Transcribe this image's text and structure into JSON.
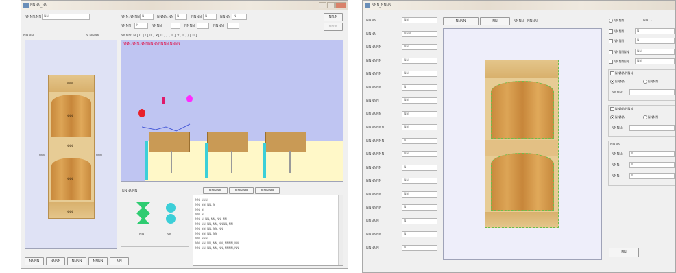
{
  "left_window": {
    "title": "NNNN_NN",
    "top_controls": {
      "field1_label": "NNNN:NN",
      "field1_value": "NN",
      "label_a": "NNN:NNNN",
      "label_b": "NNNN:NN",
      "label_c": "NNNN",
      "label_d": "NNNN",
      "button_right_top": "NN:N",
      "button_right_2": "NN:N",
      "label_e": "NNNN",
      "label_f": "NNNN",
      "label_g": "NNNN",
      "label_h": "NNNN",
      "val1": "N",
      "val2": "N",
      "val3": "N",
      "val4": "N",
      "val5": "N",
      "row3_text": "NNNN: N [ 0 ] / [ 0 ] ×[ 0 ] / [ 0 ] ×[ 0 ] / [ 0 ]",
      "left_panel_label": "NNNN",
      "left_panel_label2": "N NNNN"
    },
    "red_status_text": "NNN:NNN:NNNNNNNNNNN:NNNN",
    "preview_labels": {
      "top": "NNN",
      "upper": "NNN",
      "mid": "NNN",
      "lower": "NNN",
      "bottom": "NNN",
      "left_mark": "NNN",
      "right_mark": "NNN"
    },
    "bottom_left_panel_title": "NNNNNN",
    "legend_icons": [
      {
        "name": "green-x",
        "color": "#2ecc71",
        "label": "NN"
      },
      {
        "name": "cyan-circle",
        "color": "#3ccfd8",
        "label": "NN"
      }
    ],
    "tabs": [
      "NNNNN",
      "NNNNN",
      "NNNNN"
    ],
    "log_lines": [
      "NN: NNN",
      "NN: NN, NN, N",
      "NN: N",
      "NN: N",
      "NN: N, NN, NN, NN, NN",
      "NN: NN, NN, NN, NNNN, NN",
      "NN: NN, NN, NN, NN",
      "NN: NN, NN, NN",
      "NN: NNN",
      "NN: NN, NN, NN, NN, NNNN, NN",
      "NN: NN, NN, NN, NN, NNNN, NN"
    ],
    "bottom_buttons": [
      "NNNN",
      "NNNN",
      "NNNN",
      "NNNN",
      "NN"
    ]
  },
  "right_window": {
    "title": "NNN_NNNN",
    "fields": [
      {
        "label": "NNNN",
        "value": "NN"
      },
      {
        "label": "NNNN",
        "value": "NNN"
      },
      {
        "label": "NNNNNN",
        "value": "NN"
      },
      {
        "label": "NNNNNN",
        "value": "NN"
      },
      {
        "label": "NNNNNN",
        "value": "NN"
      },
      {
        "label": "NNNNNN",
        "value": "N"
      },
      {
        "label": "NNNNN",
        "value": "NN"
      },
      {
        "label": "NNNNNN",
        "value": "NN"
      },
      {
        "label": "NNNNNNN",
        "value": "NN"
      },
      {
        "label": "NNNNNNN",
        "value": "N"
      },
      {
        "label": "NNNNNNN",
        "value": "NN"
      },
      {
        "label": "NNNNNN",
        "value": "N"
      },
      {
        "label": "NNNNNN",
        "value": "NN"
      },
      {
        "label": "NNNNNN",
        "value": "NN"
      },
      {
        "label": "NNNNNN",
        "value": "N"
      },
      {
        "label": "NNNNN",
        "value": "N"
      },
      {
        "label": "NNNNNN",
        "value": "N"
      },
      {
        "label": "NNNNN",
        "value": "N"
      }
    ],
    "top_buttons": [
      "NNNN",
      "NN",
      "NNNN - NNNN"
    ],
    "options": {
      "opt_top": "NNNN",
      "opt_top2": "NN: -",
      "checks": [
        {
          "label": "NNNN",
          "value": "N"
        },
        {
          "label": "NNNN",
          "value": "N"
        },
        {
          "label": "NNNNNN",
          "value": "NN"
        },
        {
          "label": "NNNNNN",
          "value": "NN"
        }
      ],
      "group1_title": "NNNNNNN",
      "group1_radio_a": "NNNN",
      "group1_radio_b": "NNNN",
      "group1_field_label": "NNNN:",
      "group2_title": "NNNNNNN",
      "group2_radio_a": "NNNN",
      "group2_radio_b": "NNNN",
      "group2_field_label": "NNNN:",
      "group3_title": "NNNN",
      "group3_fields": [
        {
          "label": "NNNN:",
          "value": "N"
        },
        {
          "label": "NNN:",
          "value": "N"
        },
        {
          "label": "NNN:",
          "value": "N"
        }
      ],
      "bottom_button": "NN"
    }
  },
  "colors": {
    "wood": "#d0964a",
    "light_wood": "#e6c38a",
    "scene_bg": "#bfc5f2",
    "floor": "#fff8c8",
    "accent_cyan": "#3ccfd8",
    "red_dot": "#e8202a",
    "magenta_dot": "#ff2aff"
  }
}
